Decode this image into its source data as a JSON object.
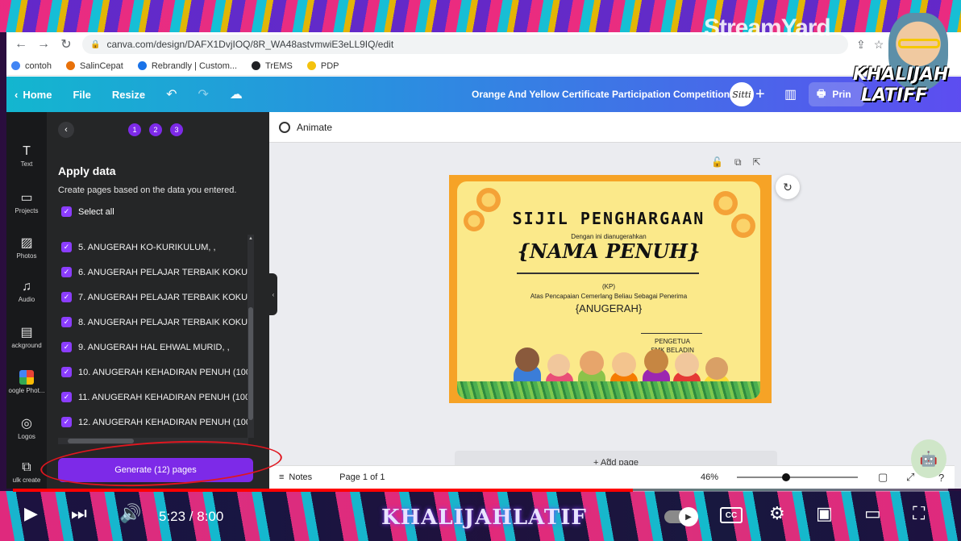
{
  "overlay": {
    "streamyard_logo": "StreamYard",
    "streamer_name_line1": "KHALIJAH",
    "streamer_name_line2": "LATIFF"
  },
  "browser": {
    "url": "canva.com/design/DAFX1DvjIOQ/8R_WA48astvmwiE3eLL9IQ/edit",
    "bookmarks": [
      {
        "label": "contoh",
        "color": "#4285f4"
      },
      {
        "label": "SalinCepat",
        "color": "#e8710a"
      },
      {
        "label": "Rebrandly | Custom...",
        "color": "#1a73e8"
      },
      {
        "label": "TrEMS",
        "color": "#202124"
      },
      {
        "label": "PDP",
        "color": "#f4c20d"
      }
    ]
  },
  "canva_header": {
    "home": "Home",
    "file": "File",
    "resize": "Resize",
    "doc_title": "Orange And Yellow Certificate Participation Competition",
    "avatar_text": "Sitti",
    "print_label": "Prin"
  },
  "rail": [
    {
      "label": "Text",
      "icon": "text-icon"
    },
    {
      "label": "Projects",
      "icon": "folder-icon"
    },
    {
      "label": "Photos",
      "icon": "photo-icon"
    },
    {
      "label": "Audio",
      "icon": "music-icon"
    },
    {
      "label": "ackground",
      "icon": "background-icon"
    },
    {
      "label": "oogle Phot...",
      "icon": "google-photos-icon"
    },
    {
      "label": "Logos",
      "icon": "logo-icon"
    },
    {
      "label": "ulk create",
      "icon": "bulk-create-icon"
    }
  ],
  "panel": {
    "steps": [
      "1",
      "2",
      "3"
    ],
    "title": "Apply data",
    "description": "Create pages based on the data you entered.",
    "select_all": "Select all",
    "items": [
      "5. ANUGERAH KO-KURIKULUM, ,",
      "6. ANUGERAH PELAJAR TERBAIK KOKUR",
      "7. ANUGERAH PELAJAR TERBAIK KOKUR",
      "8. ANUGERAH PELAJAR TERBAIK KOKUR",
      "9. ANUGERAH HAL EHWAL MURID, ,",
      "10. ANUGERAH KEHADIRAN PENUH (100",
      "11. ANUGERAH KEHADIRAN PENUH (100",
      "12. ANUGERAH KEHADIRAN PENUH (100"
    ],
    "generate_button": "Generate (12) pages"
  },
  "editor": {
    "animate": "Animate",
    "add_page": "+ Add page",
    "notes": "Notes",
    "page_indicator": "Page 1 of 1",
    "zoom": "46%"
  },
  "certificate": {
    "title": "SIJIL PENGHARGAAN",
    "subtitle": "Dengan ini dianugerahkan",
    "name_field": "{NAMA PENUH}",
    "kp_field": "(KP)",
    "achievement_text": "Atas Pencapaian Cemerlang Beliau Sebagai Penerima",
    "award_field": "{ANUGERAH}",
    "signatory_title": "PENGETUA",
    "school": "SMK BELADIN"
  },
  "player": {
    "time": "5:23 / 8:00",
    "progress_fraction": 0.663,
    "channel_banner": "KHALIJAHLATIF",
    "cc_label": "CC"
  }
}
